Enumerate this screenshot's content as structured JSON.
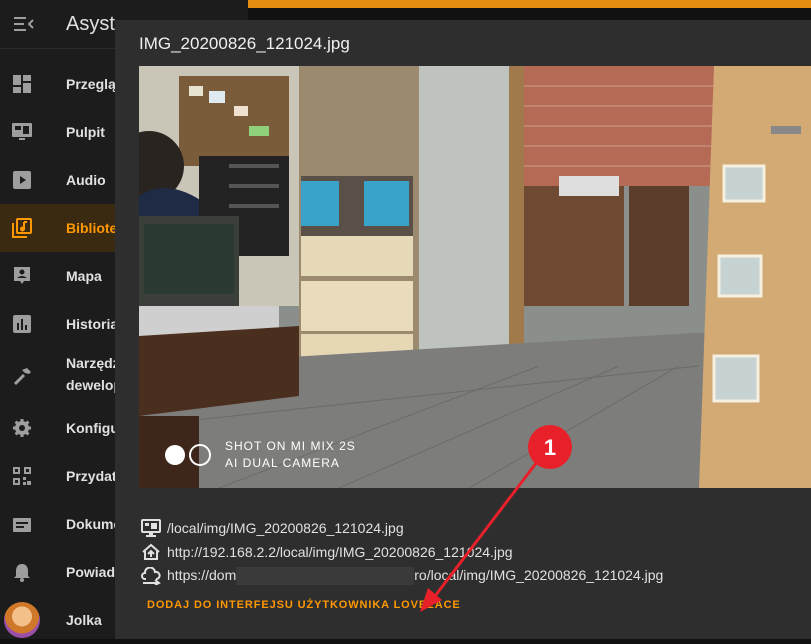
{
  "app": {
    "title": "Asyst"
  },
  "sidebar": {
    "items": [
      {
        "label": "Przeglą",
        "icon": "dashboard-icon"
      },
      {
        "label": "Pulpit",
        "icon": "monitor-dashboard-icon"
      },
      {
        "label": "Audio",
        "icon": "play-box-icon"
      },
      {
        "label": "Bibliotek",
        "icon": "music-library-icon",
        "active": true
      },
      {
        "label": "Mapa",
        "icon": "map-account-icon"
      },
      {
        "label": "Historia",
        "icon": "chart-box-icon"
      },
      {
        "label": "Narzędz",
        "label2": "dewelop",
        "icon": "hammer-icon"
      },
      {
        "label": "Konfigu",
        "icon": "cog-icon"
      },
      {
        "label": "Przydat",
        "icon": "qrcode-icon"
      },
      {
        "label": "Dokume",
        "icon": "document-icon"
      },
      {
        "label": "Powiado",
        "icon": "bell-icon"
      }
    ],
    "user": {
      "name": "Jolka"
    }
  },
  "dialog": {
    "title": "IMG_20200826_121024.jpg",
    "watermark": {
      "line1": "SHOT ON MI MIX 2S",
      "line2": "AI DUAL CAMERA"
    },
    "paths": {
      "local": "/local/img/IMG_20200826_121024.jpg",
      "internal": "http://192.168.2.2/local/img/IMG_20200826_121024.jpg",
      "external_prefix": "https://dom",
      "external_suffix": "ro/local/img/IMG_20200826_121024.jpg"
    },
    "add_button": "DODAJ DO INTERFEJSU UŻYTKOWNIKA LOVELACE"
  },
  "annotation": {
    "number": "1"
  },
  "colors": {
    "accent": "#ff9800",
    "annotation": "#e8202a"
  }
}
